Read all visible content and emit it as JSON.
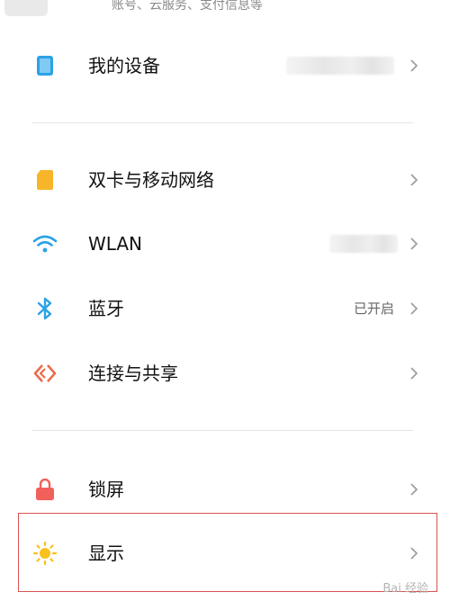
{
  "account": {
    "subtitle": "账号、云服务、支付信息等"
  },
  "groups": [
    {
      "items": [
        {
          "id": "my-device",
          "label": "我的设备",
          "value": "",
          "icon": "phone-icon"
        }
      ]
    },
    {
      "items": [
        {
          "id": "dual-sim",
          "label": "双卡与移动网络",
          "value": "",
          "icon": "sim-card-icon"
        },
        {
          "id": "wlan",
          "label": "WLAN",
          "value": "",
          "icon": "wifi-icon"
        },
        {
          "id": "bluetooth",
          "label": "蓝牙",
          "value": "已开启",
          "icon": "bluetooth-icon"
        },
        {
          "id": "connect-share",
          "label": "连接与共享",
          "value": "",
          "icon": "connection-share-icon"
        }
      ]
    },
    {
      "items": [
        {
          "id": "lock-screen",
          "label": "锁屏",
          "value": "",
          "icon": "lock-icon"
        },
        {
          "id": "display",
          "label": "显示",
          "value": "",
          "icon": "sun-icon"
        }
      ]
    }
  ],
  "watermark": {
    "text": "Bai 经验"
  },
  "colors": {
    "accent_blue": "#2aa2e6",
    "sim_yellow": "#f7b52a",
    "lock_red": "#f2605a",
    "share_orange": "#ea6c4c",
    "sun_yellow": "#f8c21b",
    "highlight_red": "#d9534f"
  }
}
